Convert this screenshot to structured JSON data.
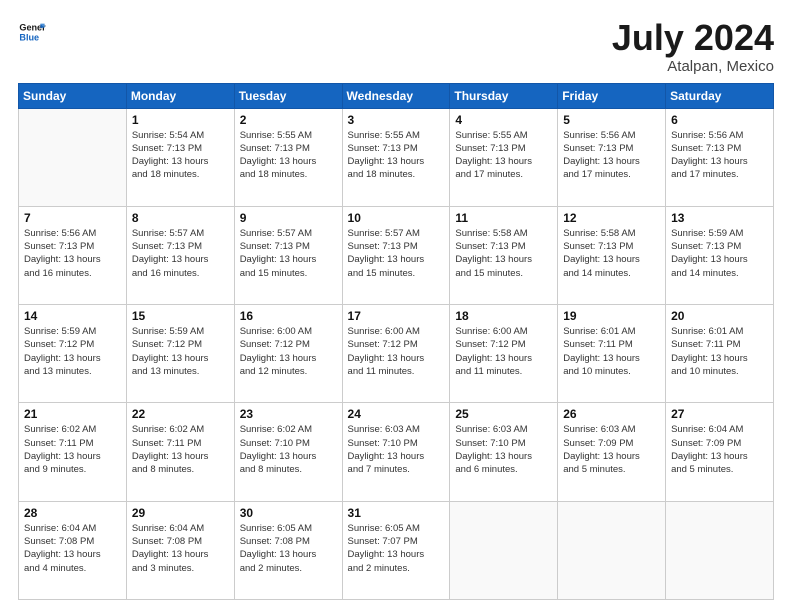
{
  "header": {
    "logo": {
      "line1": "General",
      "line2": "Blue"
    },
    "title": "July 2024",
    "location": "Atalpan, Mexico"
  },
  "weekdays": [
    "Sunday",
    "Monday",
    "Tuesday",
    "Wednesday",
    "Thursday",
    "Friday",
    "Saturday"
  ],
  "weeks": [
    [
      {
        "day": "",
        "info": ""
      },
      {
        "day": "1",
        "info": "Sunrise: 5:54 AM\nSunset: 7:13 PM\nDaylight: 13 hours\nand 18 minutes."
      },
      {
        "day": "2",
        "info": "Sunrise: 5:55 AM\nSunset: 7:13 PM\nDaylight: 13 hours\nand 18 minutes."
      },
      {
        "day": "3",
        "info": "Sunrise: 5:55 AM\nSunset: 7:13 PM\nDaylight: 13 hours\nand 18 minutes."
      },
      {
        "day": "4",
        "info": "Sunrise: 5:55 AM\nSunset: 7:13 PM\nDaylight: 13 hours\nand 17 minutes."
      },
      {
        "day": "5",
        "info": "Sunrise: 5:56 AM\nSunset: 7:13 PM\nDaylight: 13 hours\nand 17 minutes."
      },
      {
        "day": "6",
        "info": "Sunrise: 5:56 AM\nSunset: 7:13 PM\nDaylight: 13 hours\nand 17 minutes."
      }
    ],
    [
      {
        "day": "7",
        "info": "Sunrise: 5:56 AM\nSunset: 7:13 PM\nDaylight: 13 hours\nand 16 minutes."
      },
      {
        "day": "8",
        "info": "Sunrise: 5:57 AM\nSunset: 7:13 PM\nDaylight: 13 hours\nand 16 minutes."
      },
      {
        "day": "9",
        "info": "Sunrise: 5:57 AM\nSunset: 7:13 PM\nDaylight: 13 hours\nand 15 minutes."
      },
      {
        "day": "10",
        "info": "Sunrise: 5:57 AM\nSunset: 7:13 PM\nDaylight: 13 hours\nand 15 minutes."
      },
      {
        "day": "11",
        "info": "Sunrise: 5:58 AM\nSunset: 7:13 PM\nDaylight: 13 hours\nand 15 minutes."
      },
      {
        "day": "12",
        "info": "Sunrise: 5:58 AM\nSunset: 7:13 PM\nDaylight: 13 hours\nand 14 minutes."
      },
      {
        "day": "13",
        "info": "Sunrise: 5:59 AM\nSunset: 7:13 PM\nDaylight: 13 hours\nand 14 minutes."
      }
    ],
    [
      {
        "day": "14",
        "info": "Sunrise: 5:59 AM\nSunset: 7:12 PM\nDaylight: 13 hours\nand 13 minutes."
      },
      {
        "day": "15",
        "info": "Sunrise: 5:59 AM\nSunset: 7:12 PM\nDaylight: 13 hours\nand 13 minutes."
      },
      {
        "day": "16",
        "info": "Sunrise: 6:00 AM\nSunset: 7:12 PM\nDaylight: 13 hours\nand 12 minutes."
      },
      {
        "day": "17",
        "info": "Sunrise: 6:00 AM\nSunset: 7:12 PM\nDaylight: 13 hours\nand 11 minutes."
      },
      {
        "day": "18",
        "info": "Sunrise: 6:00 AM\nSunset: 7:12 PM\nDaylight: 13 hours\nand 11 minutes."
      },
      {
        "day": "19",
        "info": "Sunrise: 6:01 AM\nSunset: 7:11 PM\nDaylight: 13 hours\nand 10 minutes."
      },
      {
        "day": "20",
        "info": "Sunrise: 6:01 AM\nSunset: 7:11 PM\nDaylight: 13 hours\nand 10 minutes."
      }
    ],
    [
      {
        "day": "21",
        "info": "Sunrise: 6:02 AM\nSunset: 7:11 PM\nDaylight: 13 hours\nand 9 minutes."
      },
      {
        "day": "22",
        "info": "Sunrise: 6:02 AM\nSunset: 7:11 PM\nDaylight: 13 hours\nand 8 minutes."
      },
      {
        "day": "23",
        "info": "Sunrise: 6:02 AM\nSunset: 7:10 PM\nDaylight: 13 hours\nand 8 minutes."
      },
      {
        "day": "24",
        "info": "Sunrise: 6:03 AM\nSunset: 7:10 PM\nDaylight: 13 hours\nand 7 minutes."
      },
      {
        "day": "25",
        "info": "Sunrise: 6:03 AM\nSunset: 7:10 PM\nDaylight: 13 hours\nand 6 minutes."
      },
      {
        "day": "26",
        "info": "Sunrise: 6:03 AM\nSunset: 7:09 PM\nDaylight: 13 hours\nand 5 minutes."
      },
      {
        "day": "27",
        "info": "Sunrise: 6:04 AM\nSunset: 7:09 PM\nDaylight: 13 hours\nand 5 minutes."
      }
    ],
    [
      {
        "day": "28",
        "info": "Sunrise: 6:04 AM\nSunset: 7:08 PM\nDaylight: 13 hours\nand 4 minutes."
      },
      {
        "day": "29",
        "info": "Sunrise: 6:04 AM\nSunset: 7:08 PM\nDaylight: 13 hours\nand 3 minutes."
      },
      {
        "day": "30",
        "info": "Sunrise: 6:05 AM\nSunset: 7:08 PM\nDaylight: 13 hours\nand 2 minutes."
      },
      {
        "day": "31",
        "info": "Sunrise: 6:05 AM\nSunset: 7:07 PM\nDaylight: 13 hours\nand 2 minutes."
      },
      {
        "day": "",
        "info": ""
      },
      {
        "day": "",
        "info": ""
      },
      {
        "day": "",
        "info": ""
      }
    ]
  ]
}
